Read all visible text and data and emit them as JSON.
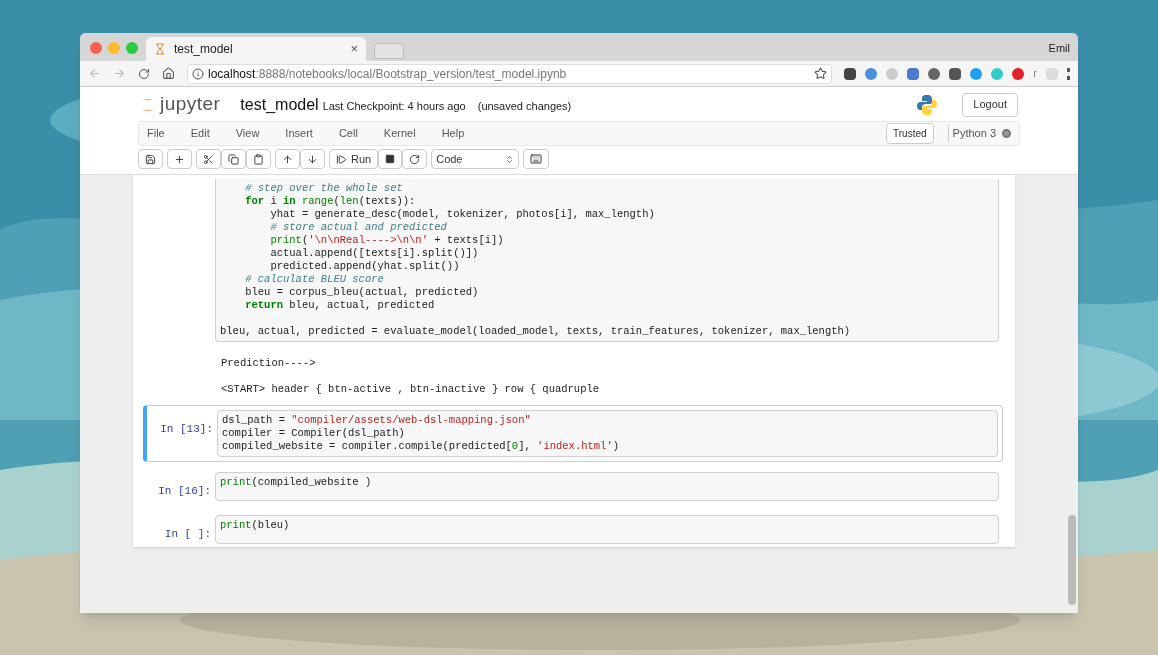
{
  "browser": {
    "tab_title": "test_model",
    "tab_close": "×",
    "user": "Emil",
    "url_host": "localhost",
    "url_rest": ":8888/notebooks/local/Bootstrap_version/test_model.ipynb",
    "extension_letter": "r"
  },
  "header": {
    "logo_text": "jupyter",
    "notebook_name": "test_model",
    "checkpoint": "Last Checkpoint: 4 hours ago",
    "unsaved": "(unsaved changes)",
    "logout": "Logout"
  },
  "menu": {
    "items": [
      "File",
      "Edit",
      "View",
      "Insert",
      "Cell",
      "Kernel",
      "Help"
    ],
    "trusted": "Trusted",
    "kernel": "Python 3",
    "kernel_busy": false
  },
  "toolbar": {
    "run": "Run",
    "cell_type": "Code"
  },
  "cells": [
    {
      "selected": false,
      "lines": [
        [
          {
            "kind": "cm",
            "t": "    # step over the whole set"
          }
        ],
        [
          {
            "kind": "kw",
            "t": "    for"
          },
          {
            "kind": "pl",
            "t": " i "
          },
          {
            "kind": "kw",
            "t": "in"
          },
          {
            "kind": "bi",
            "t": " range"
          },
          {
            "kind": "pl",
            "t": "("
          },
          {
            "kind": "bi",
            "t": "len"
          },
          {
            "kind": "pl",
            "t": "(texts)):"
          }
        ],
        [
          {
            "kind": "pl",
            "t": "        yhat = generate_desc(model, tokenizer, photos[i], max_length)"
          }
        ],
        [
          {
            "kind": "cm",
            "t": "        # store actual and predicted"
          }
        ],
        [
          {
            "kind": "bi",
            "t": "        print"
          },
          {
            "kind": "pl",
            "t": "("
          },
          {
            "kind": "st",
            "t": "'\\n\\nReal---->\\n\\n'"
          },
          {
            "kind": "pl",
            "t": " + texts[i])"
          }
        ],
        [
          {
            "kind": "pl",
            "t": "        actual.append([texts[i].split()])"
          }
        ],
        [
          {
            "kind": "pl",
            "t": "        predicted.append(yhat.split())"
          }
        ],
        [
          {
            "kind": "cm",
            "t": "    # calculate BLEU score"
          }
        ],
        [
          {
            "kind": "pl",
            "t": "    bleu = corpus_bleu(actual, predicted)"
          }
        ],
        [
          {
            "kind": "kw",
            "t": "    return"
          },
          {
            "kind": "pl",
            "t": " bleu, actual, predicted"
          }
        ],
        [
          {
            "kind": "pl",
            "gap_before": true,
            "t": "bleu, actual, predicted = evaluate_model(loaded_model, texts, train_features, tokenizer, max_length)"
          }
        ]
      ],
      "output": [
        "Prediction---->",
        "<START> header { btn-active , btn-inactive } row { quadruple"
      ]
    },
    {
      "prompt": "In [13]:",
      "selected": true,
      "lines": [
        [
          {
            "kind": "pl",
            "t": "dsl_path = "
          },
          {
            "kind": "st",
            "t": "\"compiler/assets/web-dsl-mapping.json\""
          }
        ],
        [
          {
            "kind": "pl",
            "t": "compiler = Compiler(dsl_path)"
          }
        ],
        [
          {
            "kind": "pl",
            "t": "compiled_website = compiler.compile(predicted["
          },
          {
            "kind": "nu",
            "t": "0"
          },
          {
            "kind": "pl",
            "t": "], "
          },
          {
            "kind": "st",
            "t": "'index.html'"
          },
          {
            "kind": "pl",
            "t": ")"
          }
        ]
      ]
    },
    {
      "prompt": "In [16]:",
      "selected": false,
      "lines": [
        [
          {
            "kind": "bi",
            "t": "print"
          },
          {
            "kind": "pl",
            "t": "(compiled_website )"
          }
        ]
      ]
    },
    {
      "prompt": "In [ ]:",
      "selected": false,
      "lines": [
        [
          {
            "kind": "bi",
            "t": "print"
          },
          {
            "kind": "pl",
            "t": "(bleu)"
          }
        ]
      ]
    }
  ]
}
